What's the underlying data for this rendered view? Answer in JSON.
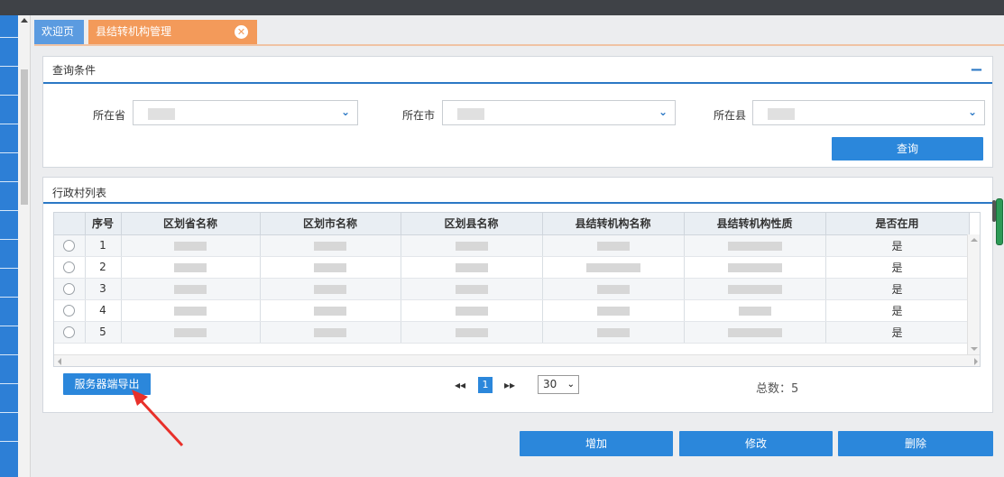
{
  "tabs": {
    "welcome": "欢迎页",
    "county": "县结转机构管理",
    "close": "✕"
  },
  "query_panel": {
    "title": "查询条件",
    "collapse": "−",
    "province_label": "所在省",
    "city_label": "所在市",
    "county_label": "所在县",
    "query_button": "查询"
  },
  "list_panel": {
    "title": "行政村列表",
    "columns": [
      "序号",
      "区划省名称",
      "区划市名称",
      "区划县名称",
      "县结转机构名称",
      "县结转机构性质",
      "是否在用"
    ],
    "rows": [
      {
        "index": "1",
        "in_use": "是"
      },
      {
        "index": "2",
        "in_use": "是"
      },
      {
        "index": "3",
        "in_use": "是"
      },
      {
        "index": "4",
        "in_use": "是"
      },
      {
        "index": "5",
        "in_use": "是"
      }
    ],
    "export_button": "服务器端导出",
    "pager": {
      "first": "◂◂",
      "page": "1",
      "last": "▸▸",
      "page_size": "30",
      "total": "总数：5"
    }
  },
  "actions": {
    "add": "增加",
    "edit": "修改",
    "delete": "删除"
  },
  "colors": {
    "accent": "#2b87db",
    "tab_active": "#f39a5a",
    "tab_inactive": "#5b9be0",
    "annotation": "#e8302a"
  }
}
